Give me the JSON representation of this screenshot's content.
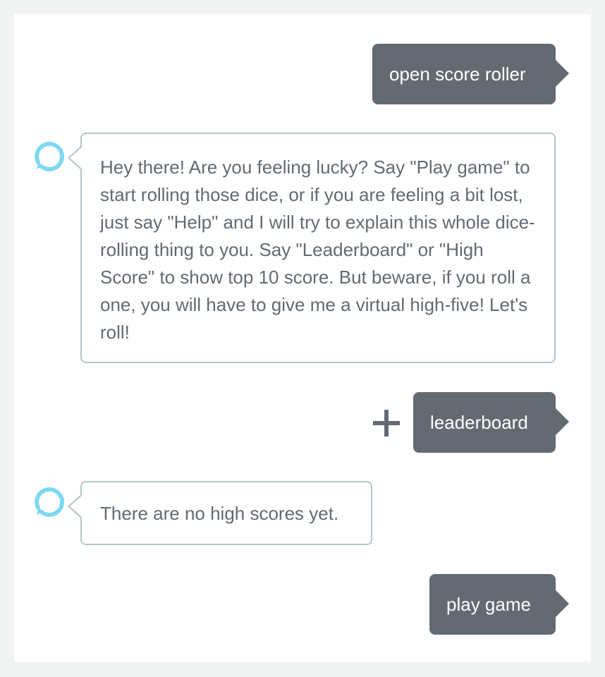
{
  "colors": {
    "background": "#f2f3f3",
    "panel": "#ffffff",
    "user_bubble": "#646a72",
    "alexa_text": "#646a72",
    "alexa_border": "#b7c4c9",
    "alexa_icon": "#7fd8f2"
  },
  "icons": {
    "alexa": "alexa-ring-icon",
    "plus": "plus-icon"
  },
  "conversation": {
    "user_1": "open score roller",
    "alexa_1": "Hey there! Are you feeling lucky? Say \"Play game\" to start rolling those dice, or if you are feeling a bit lost, just say \"Help\" and I will try to explain this whole dice-rolling thing to you. Say \"Leaderboard\" or \"High Score\" to show top 10 score. But beware, if you roll a one, you will have to give me a virtual high-five! Let's roll!",
    "user_2": "leaderboard",
    "alexa_2": "There are no high scores yet.",
    "user_3": "play game"
  }
}
